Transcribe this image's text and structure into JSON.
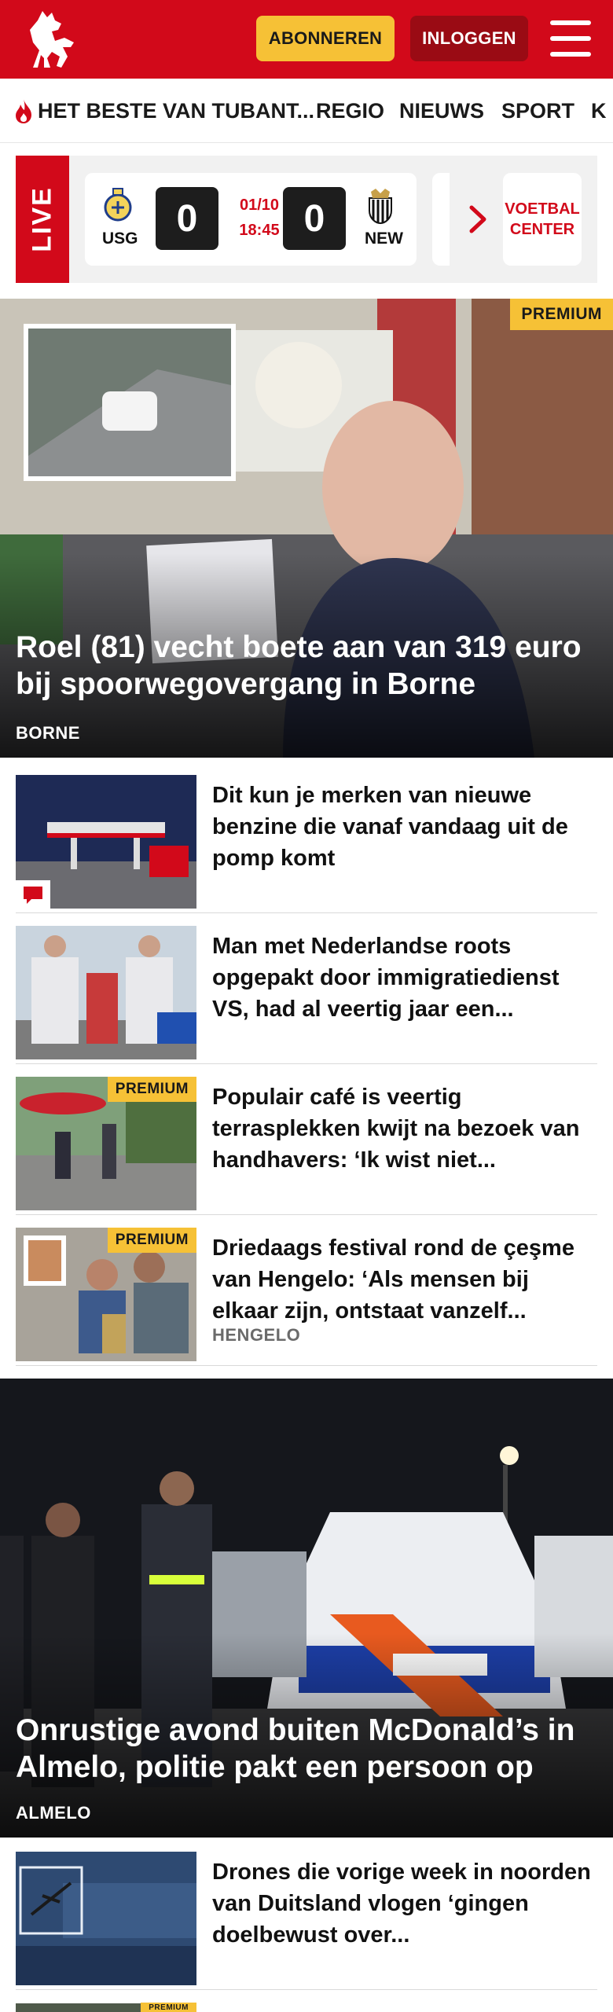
{
  "header": {
    "subscribe_label": "ABONNEREN",
    "login_label": "INLOGGEN",
    "brand_color": "#d2091a"
  },
  "nav": {
    "items": [
      {
        "label": "HET BESTE VAN TUBANT..."
      },
      {
        "label": "REGIO"
      },
      {
        "label": "NIEUWS"
      },
      {
        "label": "SPORT"
      },
      {
        "label": "K"
      }
    ]
  },
  "live": {
    "tag": "LIVE",
    "match": {
      "home_code": "USG",
      "home_score": "0",
      "date": "01/10",
      "time": "18:45",
      "away_score": "0",
      "away_code": "NEW"
    },
    "center_label": "VOETBAL CENTER"
  },
  "hero1": {
    "badge": "PREMIUM",
    "title": "Roel (81) vecht boete aan van 319 euro bij spoorwegovergang in Borne",
    "location": "BORNE"
  },
  "list1": [
    {
      "title": "Dit kun je merken van nieuwe benzine die vanaf vandaag uit de pomp komt",
      "premium": "",
      "location": ""
    },
    {
      "title": "Man met Nederlandse roots opgepakt door immigratiedienst VS, had al veertig jaar een...",
      "premium": "",
      "location": ""
    },
    {
      "title": "Populair café is veertig terrasplekken kwijt na bezoek van handhavers: ‘Ik wist niet...",
      "premium": "PREMIUM",
      "location": ""
    },
    {
      "title": "Driedaags festival rond de çeşme van Hengelo: ‘Als mensen bij elkaar zijn, ontstaat vanzelf...",
      "premium": "PREMIUM",
      "location": "HENGELO"
    }
  ],
  "hero2": {
    "title": "Onrustige avond buiten McDonald’s in Almelo, politie pakt een persoon op",
    "location": "ALMELO"
  },
  "list2": [
    {
      "title": "Drones die vorige week in noorden van Duitsland vlogen ‘gingen doelbewust over...",
      "premium": ""
    },
    {
      "title": "",
      "premium": "PREMIUM"
    }
  ]
}
